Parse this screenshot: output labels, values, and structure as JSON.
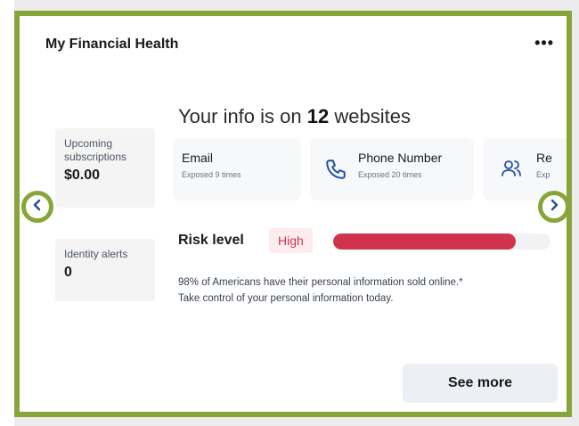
{
  "card": {
    "title": "My Financial Health",
    "more_label": "•••"
  },
  "stats": [
    {
      "label": "Upcoming subscriptions",
      "value": "$0.00"
    },
    {
      "label": "Identity alerts",
      "value": "0"
    }
  ],
  "headline": {
    "prefix": "Your info is on",
    "count": "12",
    "suffix": "websites"
  },
  "exposures": [
    {
      "title": "Email",
      "subtitle": "Exposed 9 times",
      "icon": "email"
    },
    {
      "title": "Phone Number",
      "subtitle": "Exposed 20 times",
      "icon": "phone-icon"
    },
    {
      "title": "Re",
      "subtitle": "Exp",
      "icon": "people-icon"
    }
  ],
  "risk": {
    "label": "Risk level",
    "level": "High",
    "fill_percent": 84,
    "color": "#d0344c"
  },
  "note": {
    "line1": "98% of Americans have their personal information sold online.*",
    "line2": "Take control of your personal information today."
  },
  "actions": {
    "see_more": "See more",
    "prev": "‹",
    "next": "›"
  },
  "colors": {
    "highlight_border": "#86a63a",
    "nav_arrow": "#1f4ea3",
    "risk_high": "#d0344c"
  }
}
